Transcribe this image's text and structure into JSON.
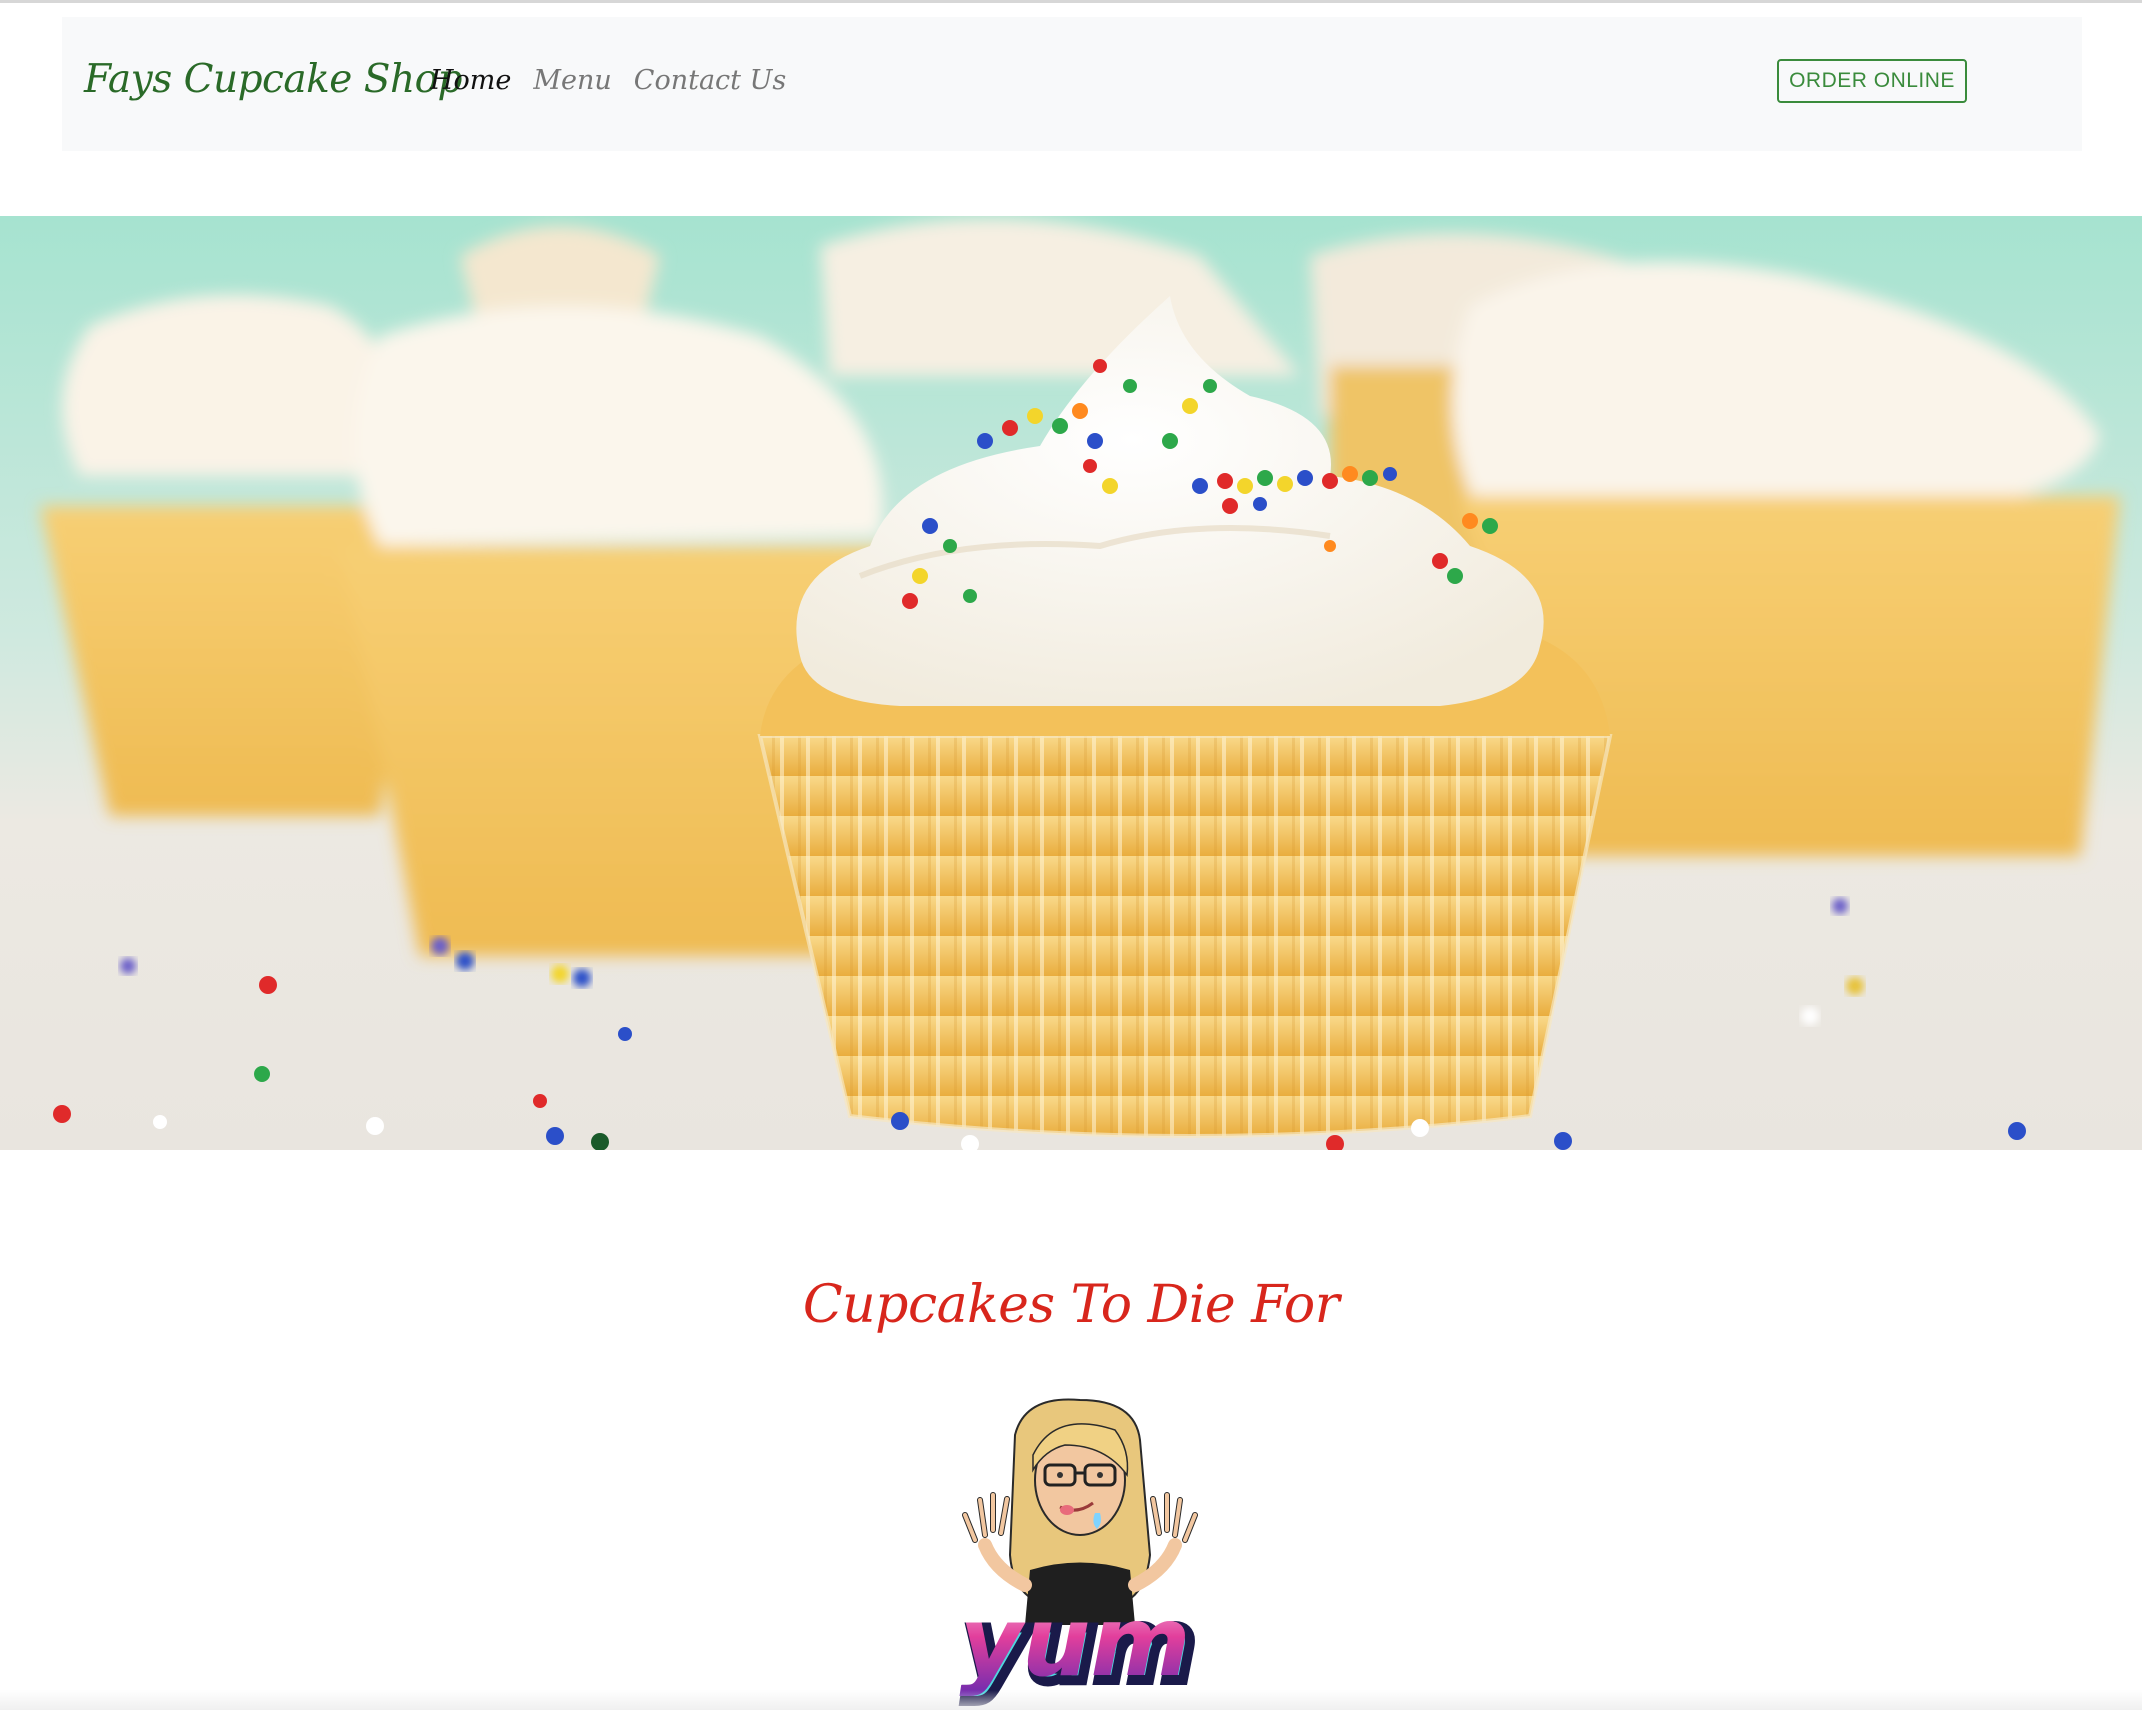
{
  "navbar": {
    "brand": "Fays Cupcake Shop",
    "links": [
      {
        "label": "Home",
        "active": true
      },
      {
        "label": "Menu",
        "active": false
      },
      {
        "label": "Contact Us",
        "active": false
      }
    ],
    "order_button": "ORDER ONLINE"
  },
  "hero": {
    "image": "cupcakes-photo",
    "colors": {
      "backdrop": "#9fe0cc",
      "frosting": "#fbf6ec",
      "cake": "#f2bb4a",
      "liner": "#f7d27a"
    }
  },
  "main": {
    "tagline": "Cupcakes To Die For",
    "sticker_text": "yum"
  },
  "theme": {
    "brand_color": "#2a6a28",
    "accent_color": "#d8261c",
    "button_color": "#3a8b3c"
  }
}
